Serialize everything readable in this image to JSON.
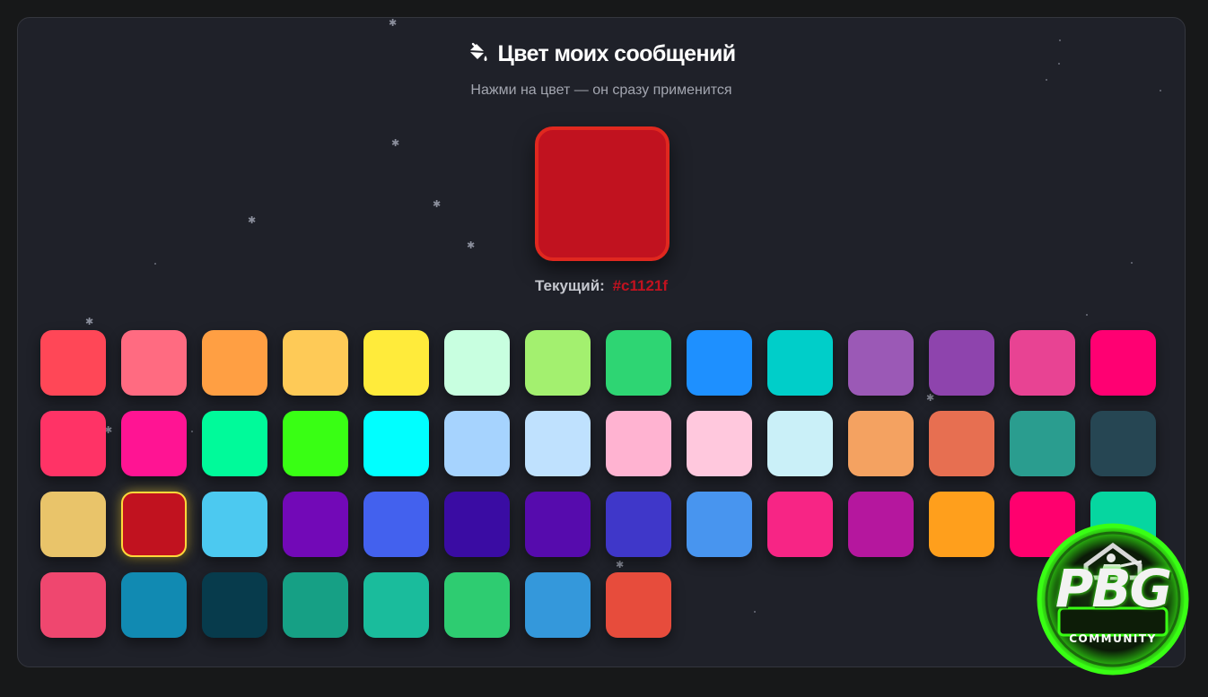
{
  "header": {
    "icon": "paint-bucket-icon",
    "title": "Цвет моих сообщений",
    "subtitle": "Нажми на цвет — он сразу применится"
  },
  "current": {
    "label": "Текущий:",
    "hex": "#c1121f",
    "color": "#c1121f"
  },
  "swatches": [
    "#ff4757",
    "#ff6b81",
    "#ff9f43",
    "#feca57",
    "#ffeb3b",
    "#c8ffe0",
    "#a3f06f",
    "#2ed573",
    "#1e90ff",
    "#00cec9",
    "#9b59b6",
    "#8e44ad",
    "#e84393",
    "#ff0072",
    "#ff3366",
    "#ff1493",
    "#00fa9a",
    "#39ff14",
    "#00ffff",
    "#a6d3fe",
    "#bfe1fe",
    "#ffb3d1",
    "#ffc8dd",
    "#caf0f8",
    "#f4a261",
    "#e76f51",
    "#2a9d8f",
    "#264653",
    "#e9c46a",
    "#c1121f",
    "#4cc9f0",
    "#7209b7",
    "#4361ee",
    "#3a0ca3",
    "#560bad",
    "#3f37c9",
    "#4895ef",
    "#f72585",
    "#b5179e",
    "#ff9f1c",
    "#ff006e",
    "#06d6a0",
    "#ef476f",
    "#118ab2",
    "#073b4c",
    "#16a085",
    "#1abc9c",
    "#2ecc71",
    "#3498db",
    "#e74c3c"
  ],
  "selected_index": 29,
  "logo": {
    "text": "PBG",
    "subtext": "COMMUNITY",
    "accent": "#39ff14"
  }
}
